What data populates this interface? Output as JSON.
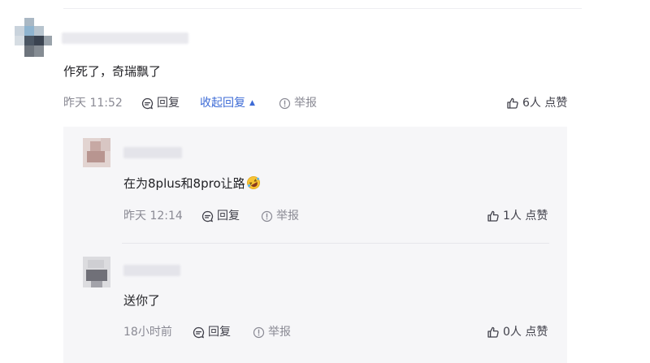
{
  "comment": {
    "content": "作死了，奇瑞飘了",
    "time": "昨天 11:52",
    "reply_label": "回复",
    "collapse_label": "收起回复",
    "report_label": "举报",
    "likes": "6人 点赞"
  },
  "replies": [
    {
      "content": "在为8plus和8pro让路",
      "emoji": "rolling-on-floor-laughing-emoji",
      "time": "昨天 12:14",
      "reply_label": "回复",
      "report_label": "举报",
      "likes": "1人 点赞"
    },
    {
      "content": "送你了",
      "time": "18小时前",
      "reply_label": "回复",
      "report_label": "举报",
      "likes": "0人 点赞"
    }
  ],
  "colors": {
    "accent": "#3d6bd6",
    "meta_text": "#8a8a94",
    "reply_background": "#f6f6f8"
  }
}
